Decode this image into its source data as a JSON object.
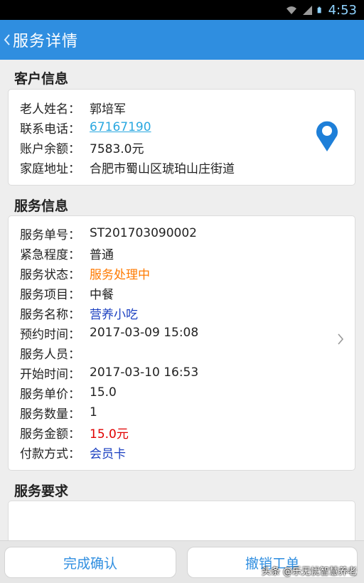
{
  "status_bar": {
    "time": "4:53",
    "icons": [
      "wifi-icon",
      "signal-icon",
      "battery-icon"
    ]
  },
  "app_bar": {
    "title": "服务详情",
    "back_icon": "back-chevron-icon"
  },
  "customer_section": {
    "title": "客户信息",
    "rows": [
      {
        "label": "老人姓名：",
        "value": "郭培军"
      },
      {
        "label": "联系电话：",
        "value": "67167190"
      },
      {
        "label": "账户余额：",
        "value": "7583.0元"
      },
      {
        "label": "家庭地址：",
        "value": "合肥市蜀山区琥珀山庄街道"
      }
    ],
    "location_icon": "map-pin-icon"
  },
  "service_section": {
    "title": "服务信息",
    "rows": [
      {
        "label": "服务单号：",
        "value": "ST201703090002"
      },
      {
        "label": "紧急程度：",
        "value": "普通"
      },
      {
        "label": "服务状态：",
        "value": "服务处理中"
      },
      {
        "label": "服务项目：",
        "value": "中餐"
      },
      {
        "label": "服务名称：",
        "value": "营养小吃"
      },
      {
        "label": "预约时间：",
        "value": "2017-03-09 15:08"
      },
      {
        "label": "服务人员：",
        "value": ""
      },
      {
        "label": "开始时间：",
        "value": "2017-03-10 16:53"
      },
      {
        "label": "服务单价：",
        "value": "15.0"
      },
      {
        "label": "服务数量：",
        "value": "1"
      },
      {
        "label": "服务金额：",
        "value": "15.0元"
      },
      {
        "label": "付款方式：",
        "value": "会员卡"
      }
    ],
    "chevron_icon": "chevron-right-icon"
  },
  "requirement_section": {
    "title": "服务要求",
    "text": ""
  },
  "bottom_bar": {
    "confirm_label": "完成确认",
    "cancel_label": "撤销工单"
  },
  "watermark": "头条 @乐无忧智慧养老",
  "colors": {
    "app_bar": "#2f8ee0",
    "link": "#2aa8e0",
    "status_orange": "#ff7a00",
    "name_blue": "#1a3fc0",
    "amount_red": "#e00000",
    "button_text": "#2f8ee0",
    "pin": "#1e7fd8"
  }
}
